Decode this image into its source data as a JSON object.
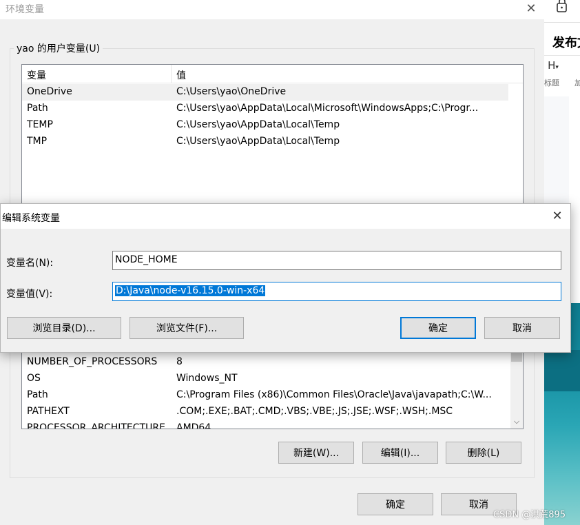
{
  "background_app": {
    "publish_label": "发布文",
    "tool1_glyph": "H",
    "tool1_label": "标题",
    "tool2_label": "加"
  },
  "env_dialog": {
    "title": "环境变量",
    "user_group_label": "yao 的用户变量(U)",
    "columns": {
      "name": "变量",
      "value": "值"
    },
    "user_vars": [
      {
        "name": "OneDrive",
        "value": "C:\\Users\\yao\\OneDrive"
      },
      {
        "name": "Path",
        "value": "C:\\Users\\yao\\AppData\\Local\\Microsoft\\WindowsApps;C:\\Progr..."
      },
      {
        "name": "TEMP",
        "value": "C:\\Users\\yao\\AppData\\Local\\Temp"
      },
      {
        "name": "TMP",
        "value": "C:\\Users\\yao\\AppData\\Local\\Temp"
      }
    ],
    "system_vars": [
      {
        "name": "NUMBER_OF_PROCESSORS",
        "value": "8"
      },
      {
        "name": "OS",
        "value": "Windows_NT"
      },
      {
        "name": "Path",
        "value": "C:\\Program Files (x86)\\Common Files\\Oracle\\Java\\javapath;C:\\W..."
      },
      {
        "name": "PATHEXT",
        "value": ".COM;.EXE;.BAT;.CMD;.VBS;.VBE;.JS;.JSE;.WSF;.WSH;.MSC"
      },
      {
        "name": "PROCESSOR_ARCHITECTURE",
        "value": "AMD64"
      }
    ],
    "sys_buttons": {
      "new": "新建(W)...",
      "edit": "编辑(I)...",
      "delete": "删除(L)"
    },
    "ok": "确定",
    "cancel": "取消"
  },
  "edit_dialog": {
    "title": "编辑系统变量",
    "name_label": "变量名(N):",
    "name_value": "NODE_HOME",
    "value_label": "变量值(V):",
    "value_value": "D:\\Java\\node-v16.15.0-win-x64",
    "browse_dir": "浏览目录(D)...",
    "browse_file": "浏览文件(F)...",
    "ok": "确定",
    "cancel": "取消"
  },
  "watermark": "CSDN @洪荒895",
  "colors": {
    "accent": "#0078d7",
    "teal_background": "#148ea1"
  }
}
